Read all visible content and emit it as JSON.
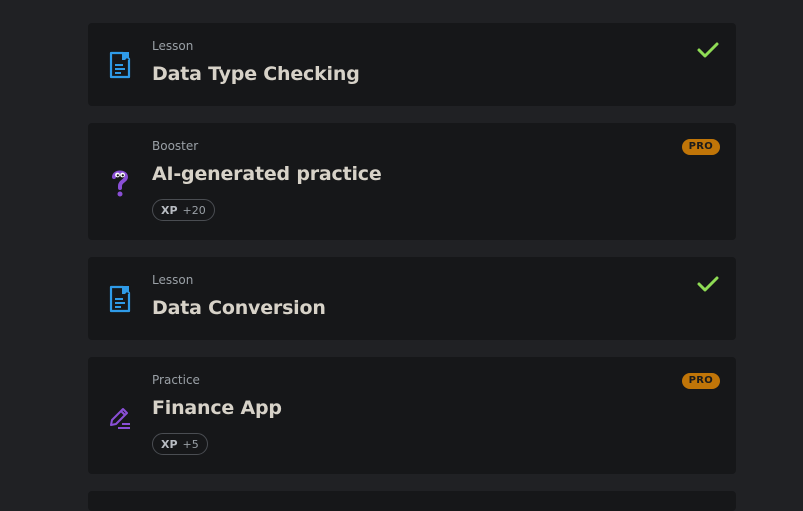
{
  "items": [
    {
      "type": "Lesson",
      "title": "Data Type Checking",
      "status": "completed",
      "icon": "lesson-doc-icon"
    },
    {
      "type": "Booster",
      "title": "AI-generated practice",
      "badge": "PRO",
      "xp_label": "XP",
      "xp_value": "+20",
      "icon": "question-mascot-icon"
    },
    {
      "type": "Lesson",
      "title": "Data Conversion",
      "status": "completed",
      "icon": "lesson-doc-icon"
    },
    {
      "type": "Practice",
      "title": "Finance App",
      "badge": "PRO",
      "xp_label": "XP",
      "xp_value": "+5",
      "icon": "pencil-edit-icon"
    }
  ],
  "colors": {
    "background": "#202124",
    "card": "#161719",
    "lesson_icon": "#2f9be8",
    "booster_icon": "#8a4fd6",
    "check": "#8fdc55",
    "pro_badge": "#c07508"
  }
}
